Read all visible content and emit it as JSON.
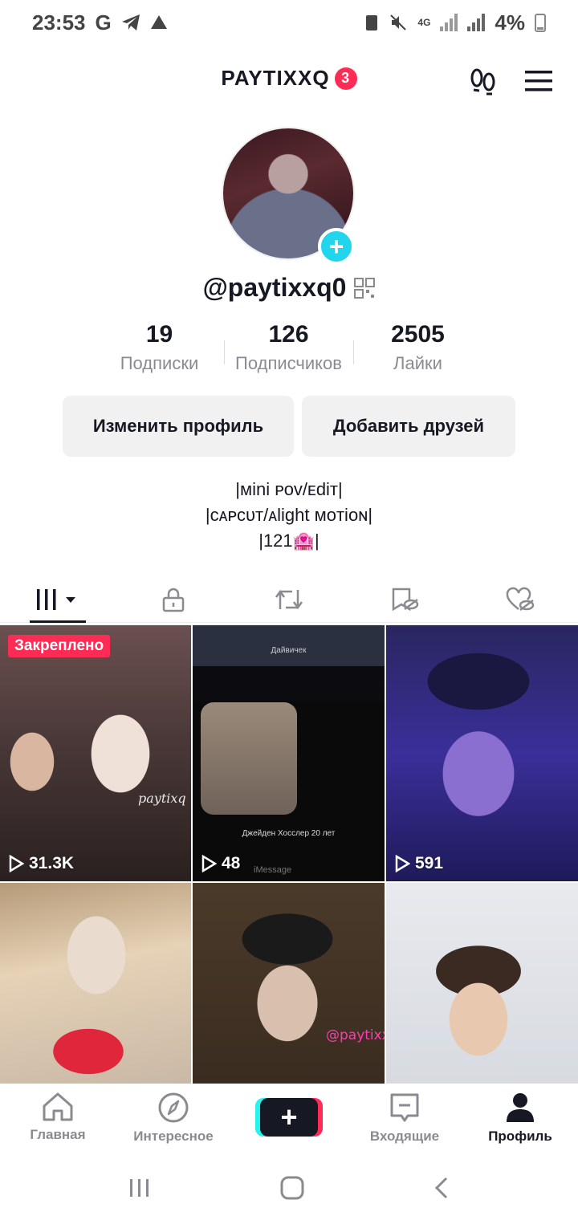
{
  "status_bar": {
    "time": "23:53",
    "carrier_glyph": "G",
    "network": "4G",
    "battery": "4%"
  },
  "header": {
    "username": "PAYTIXXQ",
    "notification_count": "3"
  },
  "profile": {
    "handle": "@paytixxq0",
    "stats": [
      {
        "value": "19",
        "label": "Подписки"
      },
      {
        "value": "126",
        "label": "Подписчиков"
      },
      {
        "value": "2505",
        "label": "Лайки"
      }
    ],
    "edit_button": "Изменить профиль",
    "add_friends_button": "Добавить друзей",
    "bio": [
      "|ᴍini ᴘᴏᴠ/ᴇdiᴛ|",
      "|ᴄᴀᴘᴄᴜᴛ/ᴀlight ᴍᴏᴛiᴏɴ|",
      "|121🏩|"
    ]
  },
  "tabs": [
    "videos",
    "private",
    "reposts",
    "saved",
    "liked"
  ],
  "videos": [
    {
      "pinned_label": "Закреплено",
      "views": "31.3K",
      "watermark": "paytixq"
    },
    {
      "views": "48",
      "phone_title": "Дайвичек",
      "phone_caption": "Джейден Хосслер 20 лет",
      "phone_input": "iMessage"
    },
    {
      "views": "591"
    },
    {
      "views": ""
    },
    {
      "views": "",
      "watermark": "@paytixxq"
    },
    {
      "views": ""
    }
  ],
  "bottom_nav": [
    {
      "label": "Главная",
      "icon": "home-icon"
    },
    {
      "label": "Интересное",
      "icon": "compass-icon"
    },
    {
      "label": "",
      "icon": "plus-icon"
    },
    {
      "label": "Входящие",
      "icon": "inbox-icon"
    },
    {
      "label": "Профиль",
      "icon": "person-icon"
    }
  ],
  "colors": {
    "accent": "#fe2c55",
    "cyan": "#25f4ee",
    "avatar_plus": "#20d5ec"
  }
}
